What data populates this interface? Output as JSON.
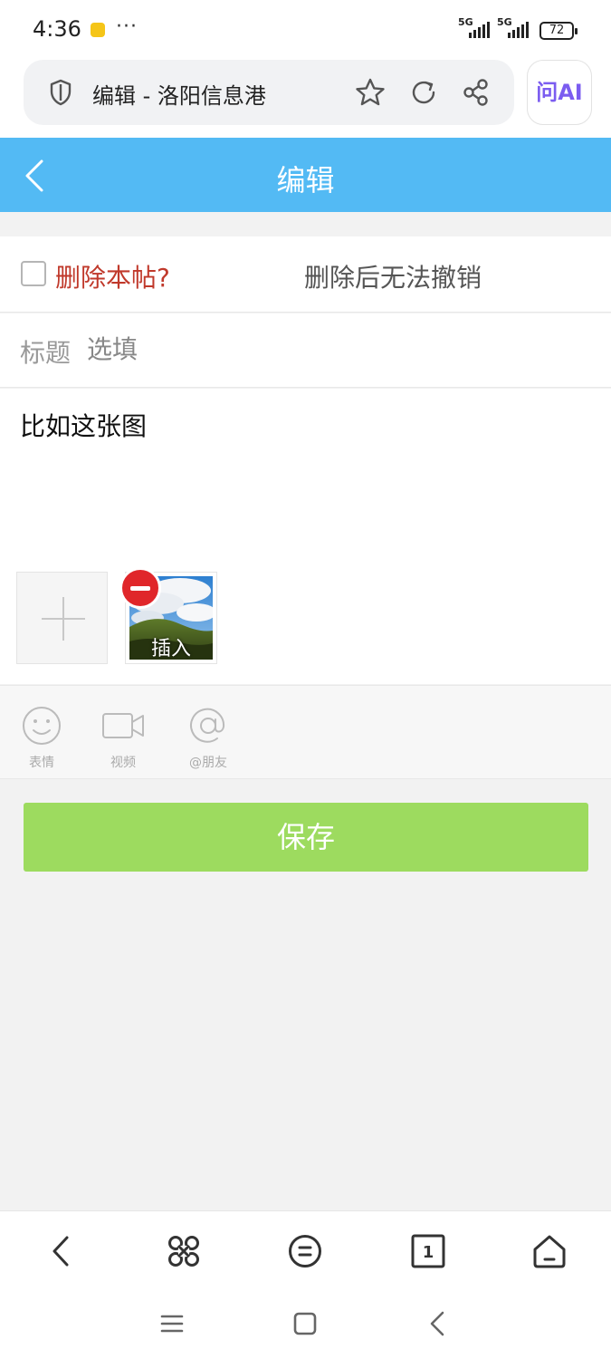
{
  "status_bar": {
    "time": "4:36",
    "dots": "···",
    "signal1_label": "5G",
    "signal2_label": "5G",
    "battery": "72"
  },
  "browser": {
    "page_title": "编辑 - 洛阳信息港",
    "ai_button": "问AI"
  },
  "header": {
    "title": "编辑"
  },
  "delete_row": {
    "label": "删除本帖?",
    "note": "删除后无法撤销",
    "checked": false
  },
  "title_row": {
    "label": "标题",
    "placeholder": "选填",
    "value": ""
  },
  "editor": {
    "content": "比如这张图",
    "attachment_label": "插入"
  },
  "toolbar": {
    "emoji_label": "表情",
    "video_label": "视频",
    "mention_label": "@朋友"
  },
  "save_button": "保存",
  "colors": {
    "header": "#53baf4",
    "save": "#9ddb5f",
    "delete_label": "#c0392b",
    "remove_badge": "#e0262a"
  },
  "icons": {
    "url_shield": "shield-icon",
    "bookmark": "star-icon",
    "reload": "refresh-icon",
    "share": "share-icon",
    "back": "chevron-left-icon",
    "nav_back": "chevron-left-icon",
    "nav_apps": "command-icon",
    "nav_menu": "menu-icon",
    "nav_tabs": "tabs-icon",
    "nav_home": "home-icon"
  }
}
